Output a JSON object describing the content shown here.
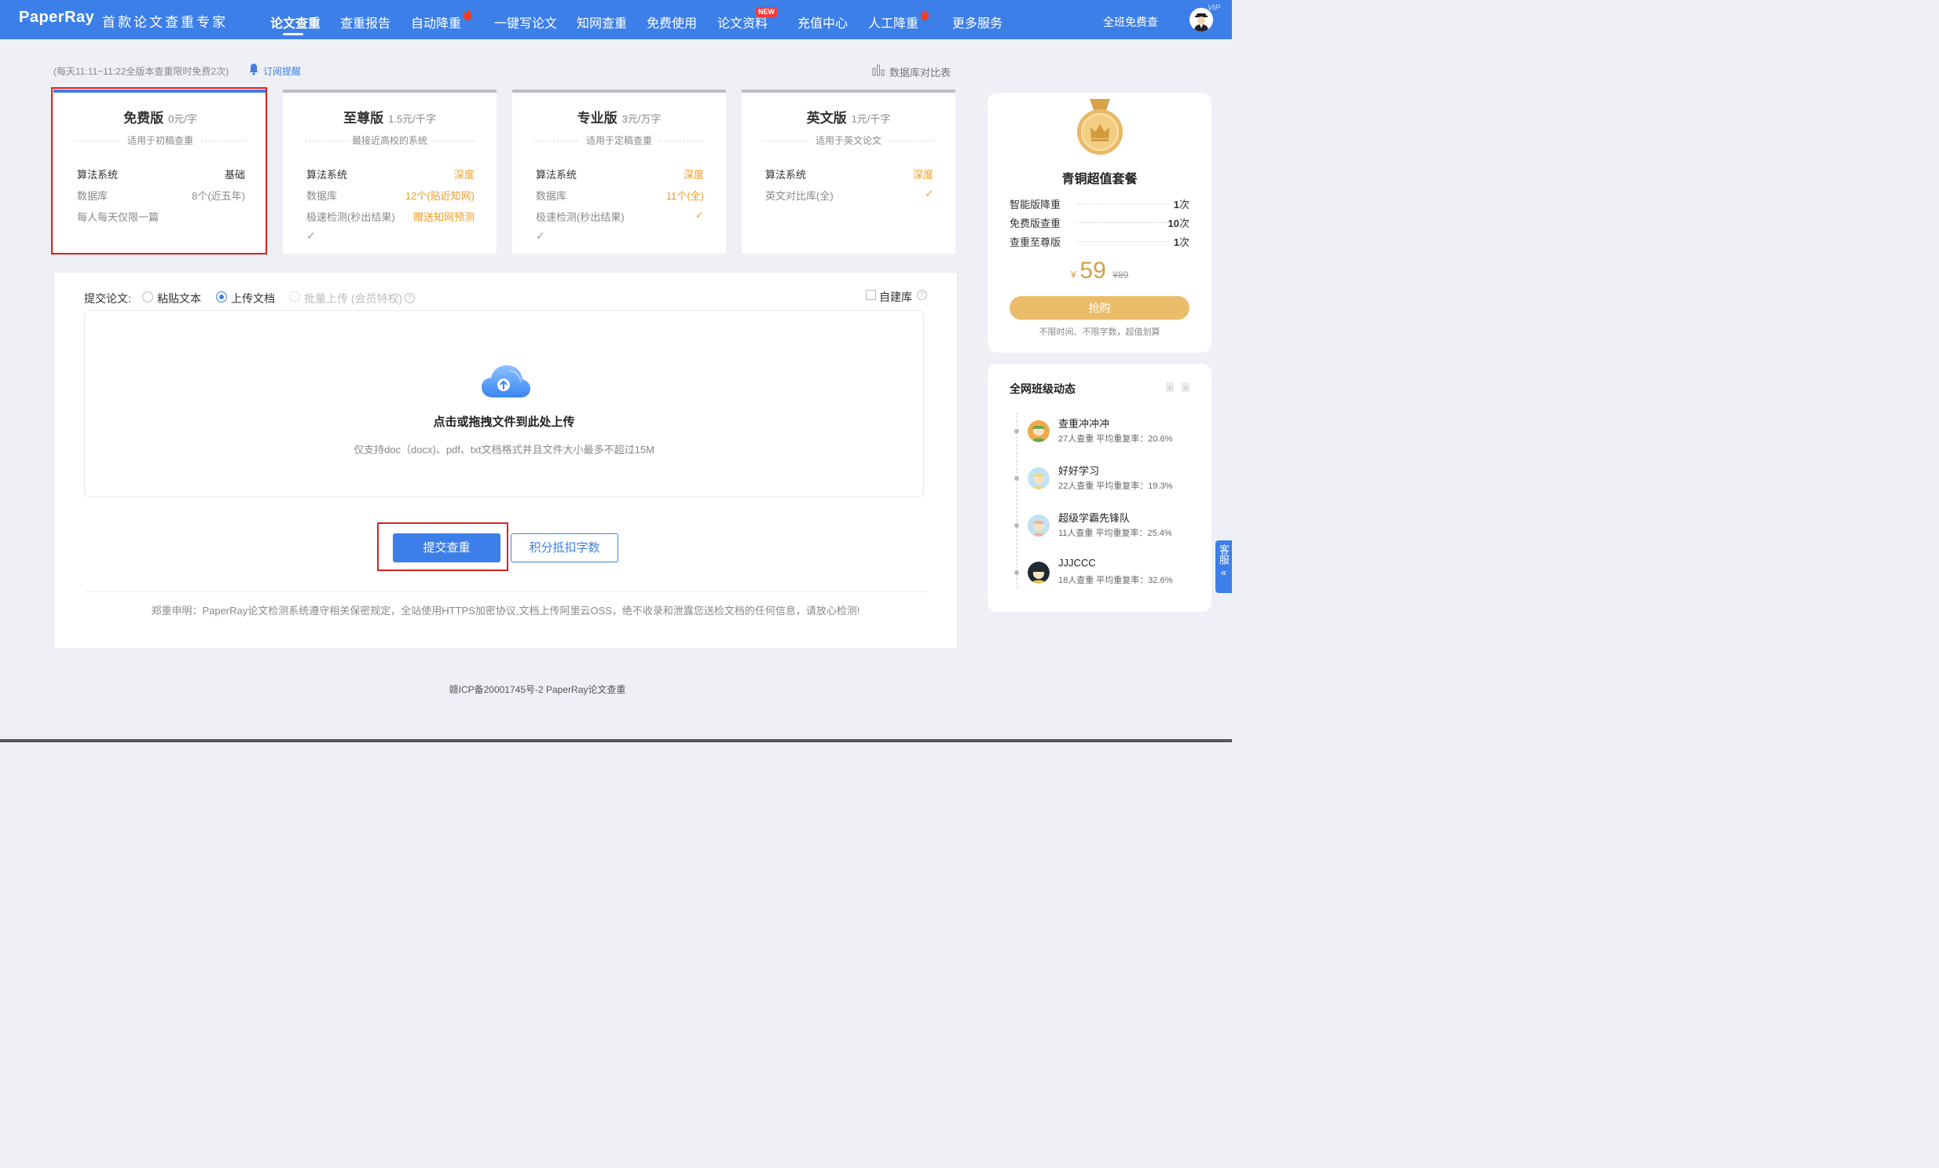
{
  "header": {
    "logo": "PaperRay",
    "slogan": "首款论文查重专家",
    "nav": [
      {
        "label": "论文查重",
        "active": true
      },
      {
        "label": "查重报告"
      },
      {
        "label": "自动降重",
        "hot": true
      },
      {
        "label": "一键写论文"
      },
      {
        "label": "知网查重"
      },
      {
        "label": "免费使用"
      },
      {
        "label": "论文资料",
        "badge": "NEW"
      },
      {
        "label": "充值中心"
      },
      {
        "label": "人工降重",
        "hot": true
      },
      {
        "label": "更多服务"
      }
    ],
    "class_free_link": "全班免费查",
    "vip_tag": "VIP"
  },
  "notice": {
    "text": "(每天11:11~11:22全版本查重限时免费2次)",
    "subscribe": "订阅提醒",
    "db_compare": "数据库对比表"
  },
  "plans": [
    {
      "name": "免费版",
      "price": "0元/字",
      "subtitle": "适用于初稿查重",
      "selected": true,
      "rows": [
        {
          "k": "算法系统",
          "v": "基础"
        },
        {
          "k": "数据库",
          "v": "8个(近五年)"
        },
        {
          "k": "每人每天仅限一篇",
          "v": ""
        }
      ]
    },
    {
      "name": "至尊版",
      "price": "1.5元/千字",
      "subtitle": "最接近高校的系统",
      "rows": [
        {
          "k": "算法系统",
          "v": "深度"
        },
        {
          "k": "数据库",
          "v": "12个(贴近知网)"
        },
        {
          "k": "极速检测(秒出结果)",
          "v": "赠送知网预测"
        }
      ],
      "extra": "✓"
    },
    {
      "name": "专业版",
      "price": "3元/万字",
      "subtitle": "适用于定稿查重",
      "rows": [
        {
          "k": "算法系统",
          "v": "深度"
        },
        {
          "k": "数据库",
          "v": "11个(全)"
        },
        {
          "k": "极速检测(秒出结果)",
          "v": "✓"
        }
      ],
      "extra": "✓"
    },
    {
      "name": "英文版",
      "price": "1元/千字",
      "subtitle": "适用于英文论文",
      "rows": [
        {
          "k": "算法系统",
          "v": "深度"
        },
        {
          "k": "英文对比库(全)",
          "v": "✓"
        }
      ]
    }
  ],
  "upload": {
    "submit_label": "提交论文:",
    "options": [
      {
        "label": "粘贴文本",
        "checked": false
      },
      {
        "label": "上传文档",
        "checked": true
      },
      {
        "label": "批量上传 (会员特权)",
        "disabled": true
      }
    ],
    "help": "?",
    "self_db": "自建库",
    "drop_title": "点击或拖拽文件到此处上传",
    "drop_hint": "仅支持doc（docx)、pdf、txt文档格式并且文件大小最多不超过15M",
    "submit_button": "提交查重",
    "points_button": "积分抵扣字数",
    "disclaimer": "郑重申明：PaperRay论文检测系统遵守相关保密规定，全站使用HTTPS加密协议,文档上传阿里云OSS，绝不收录和泄露您送检文档的任何信息，请放心检测!"
  },
  "footer": "赣ICP备20001745号-2 PaperRay论文查重",
  "package": {
    "title": "青铜超值套餐",
    "items": [
      {
        "label": "智能版降重",
        "count": "1",
        "unit": "次"
      },
      {
        "label": "免费版查重",
        "count": "10",
        "unit": "次"
      },
      {
        "label": "查重至尊版",
        "count": "1",
        "unit": "次"
      }
    ],
    "currency": "¥",
    "price": "59",
    "old_price": "¥89",
    "buy": "抢购",
    "note": "不限时间、不限字数，超值划算"
  },
  "feed": {
    "title": "全网班级动态",
    "items": [
      {
        "name": "查重冲冲冲",
        "meta": "27人查重  平均重复率：20.6%"
      },
      {
        "name": "好好学习",
        "meta": "22人查重  平均重复率：19.3%"
      },
      {
        "name": "超级学霸先锋队",
        "meta": "11人查重  平均重复率：25.4%"
      },
      {
        "name": "JJJCCC",
        "meta": "18人查重  平均重复率：32.6%"
      }
    ]
  },
  "service": {
    "label": "客服",
    "arrow": "«"
  },
  "colors": {
    "brand": "#3d7fe8",
    "accent_orange": "#f19b20",
    "gold": "#d4a04a",
    "highlight_red": "#e02020"
  }
}
